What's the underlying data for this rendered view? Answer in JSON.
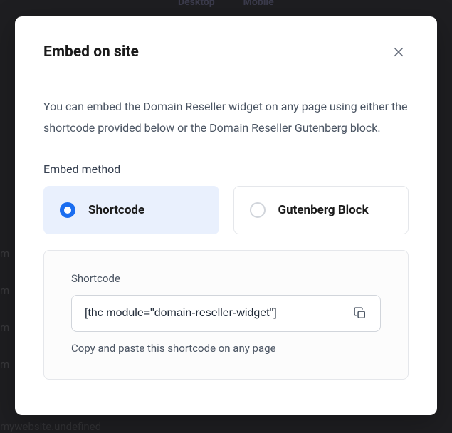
{
  "backdrop": {
    "top_left": "Desktop",
    "top_right": "Mobile",
    "side_items": [
      "m",
      "m",
      "m",
      "m"
    ],
    "bottom": "mywebsite.undefined"
  },
  "modal": {
    "title": "Embed on site",
    "description": "You can embed the Domain Reseller widget on any page using either the shortcode provided below or the Domain Reseller Gutenberg block.",
    "method_label": "Embed method",
    "options": {
      "shortcode": "Shortcode",
      "gutenberg": "Gutenberg Block"
    },
    "shortcode": {
      "label": "Shortcode",
      "value": "[thc module=\"domain-reseller-widget\"]",
      "help": "Copy and paste this shortcode on any page"
    }
  }
}
